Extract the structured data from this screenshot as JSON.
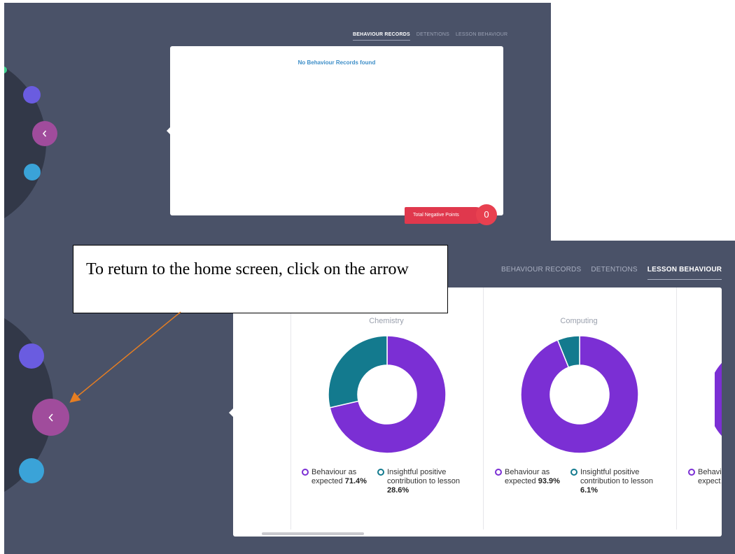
{
  "top_screen": {
    "tabs": [
      {
        "label": "BEHAVIOUR RECORDS",
        "active": true
      },
      {
        "label": "DETENTIONS",
        "active": false
      },
      {
        "label": "LESSON BEHAVIOUR",
        "active": false
      }
    ],
    "empty_message": "No Behaviour Records found",
    "negative_points_label": "Total Negative Points",
    "negative_points_value": "0",
    "back_icon": "chevron-left-icon"
  },
  "bottom_screen": {
    "tabs": [
      {
        "label": "BEHAVIOUR RECORDS",
        "active": false
      },
      {
        "label": "DETENTIONS",
        "active": false
      },
      {
        "label": "LESSON BEHAVIOUR",
        "active": true
      }
    ],
    "back_icon": "chevron-left-icon",
    "subjects": [
      {
        "name": "Chemistry",
        "legend": [
          {
            "label": "Behaviour as expected",
            "value": "71.4%"
          },
          {
            "label": "Insightful positive contribution to lesson",
            "value": "28.6%"
          }
        ]
      },
      {
        "name": "Computing",
        "legend": [
          {
            "label": "Behaviour as expected",
            "value": "93.9%"
          },
          {
            "label": "Insightful positive contribution to lesson",
            "value": "6.1%"
          }
        ]
      }
    ],
    "partial_legend_label": "Behavi… expect…"
  },
  "callout": {
    "text": "To return to the home screen, click on the arrow"
  },
  "colors": {
    "background": "#4a5268",
    "purple": "#7b2fd4",
    "teal": "#137a8e",
    "back_button": "#a04c9c",
    "red": "#e84050"
  },
  "chart_data": [
    {
      "type": "pie",
      "title": "Chemistry",
      "categories": [
        "Behaviour as expected",
        "Insightful positive contribution to lesson"
      ],
      "values": [
        71.4,
        28.6
      ]
    },
    {
      "type": "pie",
      "title": "Computing",
      "categories": [
        "Behaviour as expected",
        "Insightful positive contribution to lesson"
      ],
      "values": [
        93.9,
        6.1
      ]
    }
  ]
}
